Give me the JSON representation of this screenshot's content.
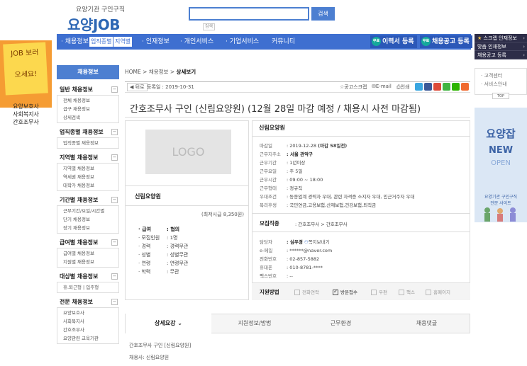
{
  "header": {
    "logo_sub": "요양기관 구인구직",
    "logo_kr": "요양",
    "logo_en": "JOB",
    "search_button": "검색",
    "search_hint": "검색"
  },
  "gnb": {
    "items": [
      "채용정보",
      "인재정보",
      "개인서비스",
      "기업서비스",
      "커뮤니티"
    ],
    "tags": [
      "업직종별",
      "지역별"
    ],
    "resume_btn": "이력서 등록",
    "post_btn": "채용공고 등록",
    "free_badge": "무료"
  },
  "right_sidebar": {
    "menu": [
      "스크랩 인재정보",
      "맞춤 인재정보",
      "채용공고 등록"
    ],
    "links": [
      "고객센터",
      "서비스안내"
    ],
    "top": "TOP",
    "banner": {
      "t1": "요양잡",
      "t2": "NEW",
      "t3": "OPEN",
      "t4a": "요양기관 구인구직",
      "t4b": "전문 사이트"
    }
  },
  "left_ad": {
    "note1": "JOB 보러",
    "note2": "오세요!",
    "caption": [
      "요양보호사",
      "사회복지사",
      "간호조무사"
    ]
  },
  "lnb": {
    "head": "채용정보",
    "sections": [
      {
        "title": "일반 채용정보",
        "items": [
          "전체 채용정보",
          "급구 채용정보",
          "상세검색"
        ]
      },
      {
        "title": "업직종별 채용정보",
        "items": [
          "업직종별 채용정보"
        ]
      },
      {
        "title": "지역별 채용정보",
        "items": [
          "지역별 채용정보",
          "역세권 채용정보",
          "대학가 채용정보"
        ]
      },
      {
        "title": "기간별 채용정보",
        "items": [
          "근무기간/요일/시간별",
          "단기 채용정보",
          "장기 채용정보"
        ]
      },
      {
        "title": "급여별 채용정보",
        "items": [
          "급여별 채용정보",
          "지원별 채용정보"
        ]
      },
      {
        "title": "대상별 채용정보",
        "items": [
          "휴.퇴근형 | 입주형"
        ]
      },
      {
        "title": "전문 채용정보",
        "items": [
          "요양보호사",
          "사회복지사",
          "간호조무사",
          "요양관련 교육기관"
        ]
      }
    ]
  },
  "breadcrumb": {
    "home": "HOME",
    "sep": ">",
    "mid": "채용정보",
    "cur": "상세보기"
  },
  "toolbar": {
    "back": "뒤로",
    "date_label": "등록일 : 2019-10-31",
    "scrap": "공고스크랩",
    "email": "E-mail",
    "print": "인쇄"
  },
  "job": {
    "title": "간호조무사 구인 (신림요양원) (12월 28일 마감 예정 / 채용시 사전 마감됨)",
    "logo_text": "LOGO",
    "company": "신림요양원",
    "minwage": "(최저시급 8,350원)",
    "conditions": [
      {
        "k": "· 급여",
        "v": ": 협의",
        "bold": true
      },
      {
        "k": "· 모집인원",
        "v": ": 1명"
      },
      {
        "k": "· 경력",
        "v": ": 경력무관"
      },
      {
        "k": "· 성별",
        "v": ": 성별무관"
      },
      {
        "k": "· 연령",
        "v": ": 연령무관"
      },
      {
        "k": "· 학력",
        "v": ": 무관"
      }
    ]
  },
  "detail": {
    "company": "신림요양원",
    "rows": [
      {
        "k": "마감일",
        "v": ": 2019-12-28",
        "extra": "(마감 58일전)"
      },
      {
        "k": "근무지주소",
        "v": ": 서울 관악구"
      },
      {
        "k": "근무기간",
        "v": ": 1년이상"
      },
      {
        "k": "근무요일",
        "v": ": 주 5일"
      },
      {
        "k": "근무시간",
        "v": ": 09:00 ~ 18:00"
      },
      {
        "k": "근무형태",
        "v": ": 정규직"
      },
      {
        "k": "우대조건",
        "v": ": 동종업계 경력자 우대, 관련 자격증 소지자 우대, 인근거주자 우대"
      },
      {
        "k": "복리후생",
        "v": ": 국민연금,고용보험,산재보험,건강보험,퇴직금"
      }
    ],
    "field_label": "모집직종",
    "field_value": ": 간호조무사 > 간호조무사",
    "contact": [
      {
        "k": "담당자",
        "v": ": 심우경",
        "extra": "쪽지보내기"
      },
      {
        "k": "e-메일",
        "v": ": ******@naver.com"
      },
      {
        "k": "전화번호",
        "v": ": 02-857-5882"
      },
      {
        "k": "휴대폰",
        "v": ": 010-8781-****"
      },
      {
        "k": "팩스번호",
        "v": ": --"
      }
    ],
    "apply_label": "지원방법",
    "apply_opts": [
      {
        "label": "전화연락",
        "on": false
      },
      {
        "label": "방문접수",
        "on": true
      },
      {
        "label": "우편",
        "on": false
      },
      {
        "label": "팩스",
        "on": false
      },
      {
        "label": "홈페이지",
        "on": false
      }
    ]
  },
  "tabs": [
    "상세요강",
    "지원정보/방법",
    "근무환경",
    "채용댓글"
  ],
  "tab_active_suffix": "⌄",
  "body": {
    "line1": "간호조무사 구인 [신림요양원]",
    "line2": "채용사: 신림요양원"
  }
}
